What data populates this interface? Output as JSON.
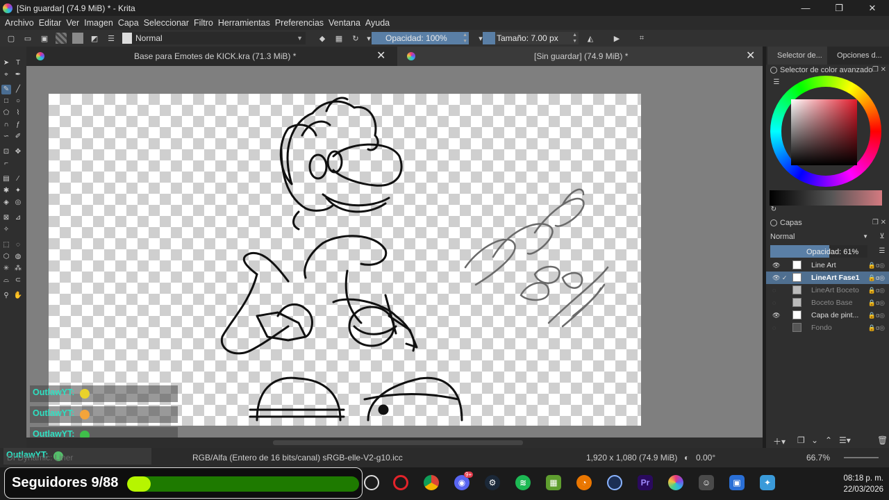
{
  "window": {
    "title": "[Sin guardar]  (74.9 MiB) * - Krita",
    "controls": [
      "—",
      "❐",
      "✕"
    ]
  },
  "menu": [
    "Archivo",
    "Editar",
    "Ver",
    "Imagen",
    "Capa",
    "Seleccionar",
    "Filtro",
    "Herramientas",
    "Preferencias",
    "Ventana",
    "Ayuda"
  ],
  "toolbar": {
    "blend_mode": "Normal",
    "opacity_label": "Opacidad: 100%",
    "opacity_fraction": 1.0,
    "size_label": "Tamaño: 7.00 px"
  },
  "tabs": [
    {
      "label": "Base para Emotes de KICK.kra (71.3 MiB) *"
    },
    {
      "label": "[Sin guardar]  (74.9 MiB) *"
    }
  ],
  "dockers": {
    "tab1": "Selector de...",
    "tab2": "Opciones d...",
    "color_title": "Selector de color avanzado",
    "layers_title": "Capas",
    "layers_blend": "Normal",
    "layers_opacity": "Opacidad:  61%",
    "layers_opacity_fraction": 0.61
  },
  "layers": [
    {
      "name": "Line Art",
      "visible": true,
      "selected": false
    },
    {
      "name": "LineArt Fase1",
      "visible": true,
      "selected": true
    },
    {
      "name": "LineArt Boceto",
      "visible": false,
      "selected": false
    },
    {
      "name": "Boceto Base",
      "visible": false,
      "selected": false
    },
    {
      "name": "Capa de pint...",
      "visible": true,
      "selected": false
    },
    {
      "name": "Fondo",
      "visible": false,
      "selected": false
    }
  ],
  "status": {
    "left": "DI Dynamic: Liner",
    "color_space": "RGB/Alfa (Entero de 16 bits/canal)  sRGB-elle-V2-g10.icc",
    "dimensions": "1,920 x 1,080 (74.9 MiB)",
    "rotation": "0.00°",
    "zoom": "66.7%"
  },
  "chat": [
    {
      "user": "OutlawYT:",
      "emote_color": "#e9d22a"
    },
    {
      "user": "OutlawYT:",
      "emote_color": "#f3a43a"
    },
    {
      "user": "OutlawYT:",
      "emote_color": "#3fbf4a"
    },
    {
      "user": "OutlawYT:",
      "emote_color": "#53c06a"
    }
  ],
  "followers": {
    "label": "Seguidores 9/88",
    "current": 9,
    "goal": 88
  },
  "taskbar": {
    "icons": [
      "obs-icon",
      "opera-icon",
      "chrome-icon",
      "discord-icon",
      "steam-icon",
      "spotify-icon",
      "minecraft-icon",
      "blender-icon",
      "cinema4d-icon",
      "premiere-icon",
      "krita-icon",
      "game-icon",
      "store-icon",
      "app-icon"
    ],
    "discord_badge": "9+",
    "time": "08:18 p. m.",
    "date": "22/03/2026"
  },
  "colors": {
    "accent": "#5a7fa6",
    "chat_user": "#2fe0c2",
    "follower_fill": "#b6f500"
  }
}
